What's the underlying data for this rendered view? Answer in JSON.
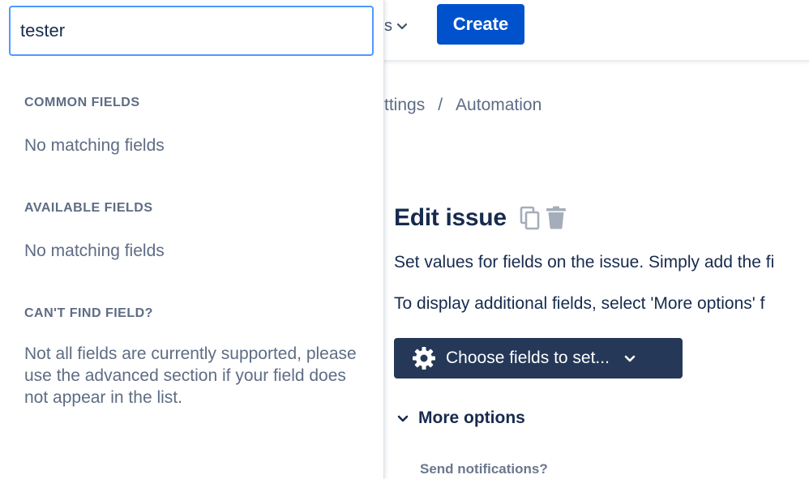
{
  "header": {
    "nav_menu_label": "s",
    "create_button_label": "Create"
  },
  "breadcrumb": {
    "items": [
      "ttings",
      "Automation"
    ],
    "separator": "/"
  },
  "action_panel": {
    "title": "Edit issue",
    "description_1": "Set values for fields on the issue. Simply add the fi",
    "description_2": "To display additional fields, select 'More options' f",
    "choose_fields_button_label": "Choose fields to set...",
    "more_options_label": "More options",
    "send_notifications_label": "Send notifications?"
  },
  "field_dropdown": {
    "search": {
      "value": "tester"
    },
    "sections": {
      "common": {
        "heading": "COMMON FIELDS",
        "text": "No matching fields"
      },
      "available": {
        "heading": "AVAILABLE FIELDS",
        "text": "No matching fields"
      },
      "cant_find": {
        "heading": "CAN'T FIND FIELD?",
        "text": "Not all fields are currently supported, please use the advanced section if your field does not appear in the list."
      }
    }
  },
  "icons": {
    "copy": "copy-icon",
    "delete": "trash-icon",
    "settings": "gear-icon",
    "expand": "chevron-down-icon"
  },
  "colors": {
    "primary_button": "#0052cc",
    "dark_button": "#253858",
    "focus_border": "#4c9aff",
    "text_primary": "#172b4d",
    "text_subtle": "#5e6c84"
  }
}
